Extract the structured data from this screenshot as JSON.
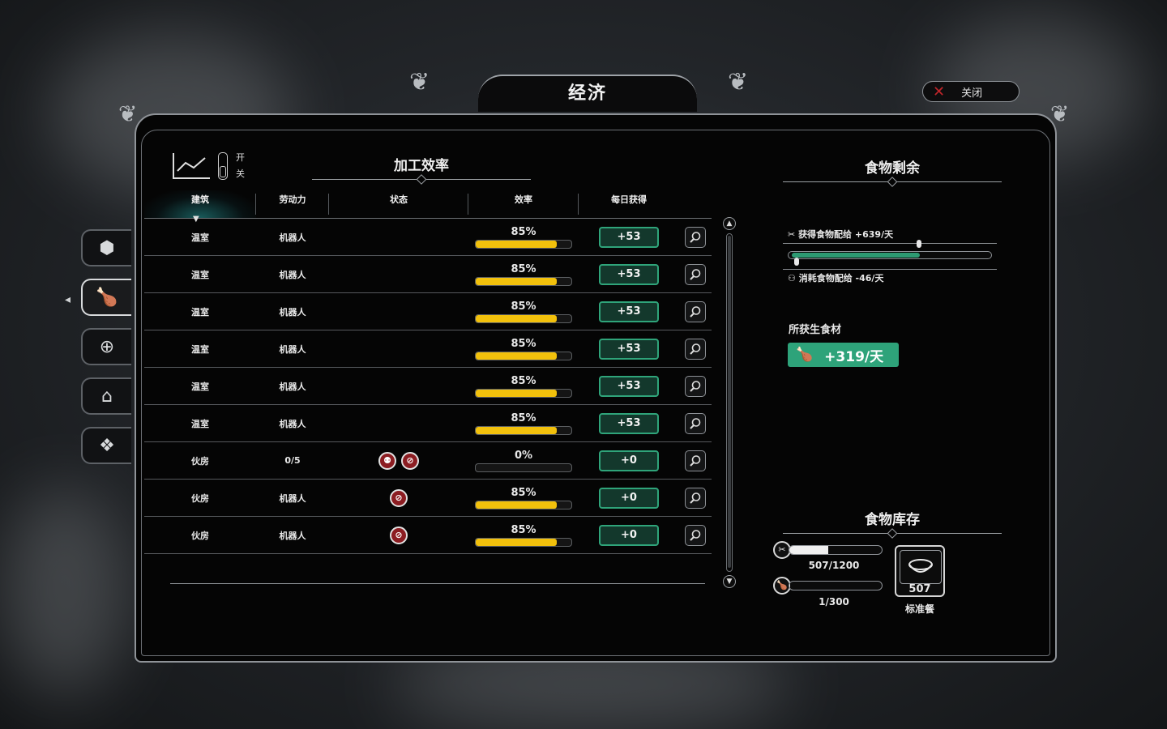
{
  "window": {
    "title": "经济",
    "close_label": "关闭"
  },
  "sidebar": {
    "tabs": [
      {
        "icon": "hexagon-resource-icon",
        "active": false
      },
      {
        "icon": "food-drumstick-icon",
        "active": true
      },
      {
        "icon": "medical-plus-icon",
        "active": false
      },
      {
        "icon": "house-icon",
        "active": false
      },
      {
        "icon": "diamonds-icon",
        "active": false
      }
    ]
  },
  "processing": {
    "title": "加工效率",
    "toggle_on": "开",
    "toggle_off": "关",
    "columns": {
      "building": "建筑",
      "workforce": "劳动力",
      "status": "状态",
      "efficiency": "效率",
      "daily": "每日获得"
    },
    "rows": [
      {
        "building": "温室",
        "workforce": "机器人",
        "status": [],
        "efficiency": "85%",
        "efficiency_value": 85,
        "daily": "+53"
      },
      {
        "building": "温室",
        "workforce": "机器人",
        "status": [],
        "efficiency": "85%",
        "efficiency_value": 85,
        "daily": "+53"
      },
      {
        "building": "温室",
        "workforce": "机器人",
        "status": [],
        "efficiency": "85%",
        "efficiency_value": 85,
        "daily": "+53"
      },
      {
        "building": "温室",
        "workforce": "机器人",
        "status": [],
        "efficiency": "85%",
        "efficiency_value": 85,
        "daily": "+53"
      },
      {
        "building": "温室",
        "workforce": "机器人",
        "status": [],
        "efficiency": "85%",
        "efficiency_value": 85,
        "daily": "+53"
      },
      {
        "building": "温室",
        "workforce": "机器人",
        "status": [],
        "efficiency": "85%",
        "efficiency_value": 85,
        "daily": "+53"
      },
      {
        "building": "伙房",
        "workforce": "0/5",
        "status": [
          "workers-missing-icon",
          "no-entry-icon"
        ],
        "efficiency": "0%",
        "efficiency_value": 0,
        "daily": "+0"
      },
      {
        "building": "伙房",
        "workforce": "机器人",
        "status": [
          "no-entry-icon"
        ],
        "efficiency": "85%",
        "efficiency_value": 85,
        "daily": "+0"
      },
      {
        "building": "伙房",
        "workforce": "机器人",
        "status": [
          "no-entry-icon"
        ],
        "efficiency": "85%",
        "efficiency_value": 85,
        "daily": "+0"
      }
    ]
  },
  "food_surplus": {
    "title": "食物剩余",
    "gained_label": "获得食物配给 +639/天",
    "consumed_label": "消耗食物配给 -46/天",
    "raw_label": "所获生食材",
    "raw_value": "+319/天"
  },
  "food_stock": {
    "title": "食物库存",
    "rations": "507/1200",
    "rations_fraction": 0.4225,
    "raw": "1/300",
    "raw_fraction": 0.0033,
    "meal_count": "507",
    "meal_name": "标准餐"
  },
  "colors": {
    "accent_green": "#2ea37a",
    "efficiency_yellow": "#f2c10c",
    "warning_red": "#8c1d22"
  }
}
